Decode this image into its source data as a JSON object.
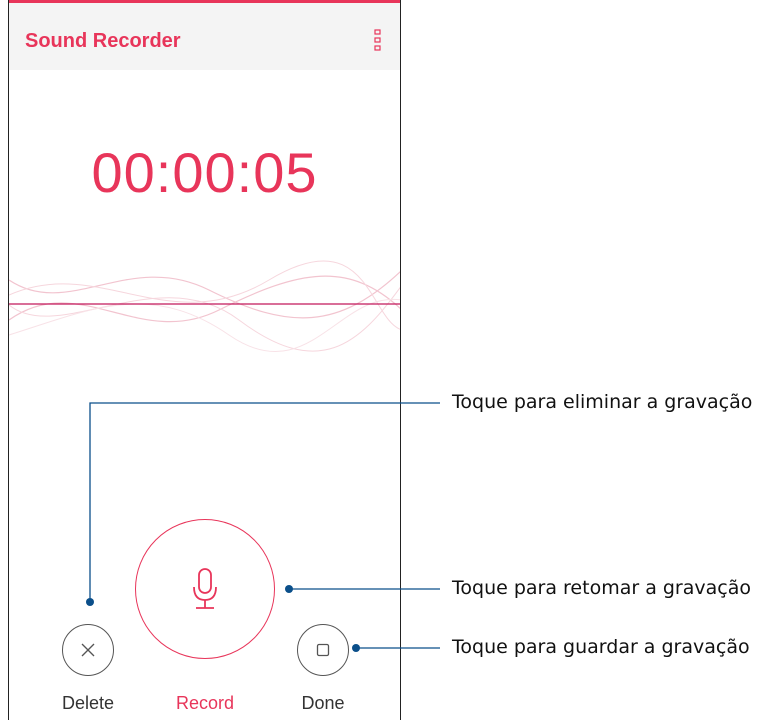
{
  "app": {
    "title": "Sound Recorder"
  },
  "timer": {
    "value": "00:00:05"
  },
  "controls": {
    "delete_label": "Delete",
    "record_label": "Record",
    "done_label": "Done"
  },
  "annotations": {
    "delete": "Toque para eliminar a gravação",
    "record": "Toque para retomar a gravação",
    "done": "Toque para guardar a gravação"
  },
  "icons": {
    "menu": "more-vert-icon",
    "delete": "close-icon",
    "record": "microphone-icon",
    "done": "stop-icon"
  },
  "colors": {
    "accent": "#e8355a",
    "annotation_line": "#0b4f8a"
  }
}
